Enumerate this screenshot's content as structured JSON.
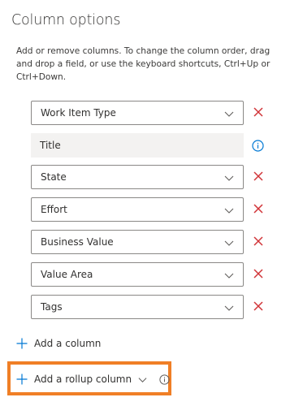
{
  "panel": {
    "title": "Column options",
    "description": "Add or remove columns. To change the column order, drag and drop a field, or use the keyboard shortcuts, Ctrl+Up or Ctrl+Down."
  },
  "columns": [
    {
      "label": "Work Item Type",
      "kind": "select",
      "removable": true
    },
    {
      "label": "Title",
      "kind": "static",
      "removable": false
    },
    {
      "label": "State",
      "kind": "select",
      "removable": true
    },
    {
      "label": "Effort",
      "kind": "select",
      "removable": true
    },
    {
      "label": "Business Value",
      "kind": "select",
      "removable": true
    },
    {
      "label": "Value Area",
      "kind": "select",
      "removable": true
    },
    {
      "label": "Tags",
      "kind": "select",
      "removable": true
    }
  ],
  "actions": {
    "add_column": "Add a column",
    "add_rollup_column": "Add a rollup column"
  },
  "colors": {
    "remove": "#d13438",
    "accent": "#0078d4",
    "highlight": "#f07f26",
    "static_bg": "#f3f2f1",
    "border": "#8a8886"
  },
  "icons": {
    "chevron": "chevron-down-icon",
    "remove": "close-icon",
    "info": "info-icon",
    "add": "plus-icon"
  }
}
